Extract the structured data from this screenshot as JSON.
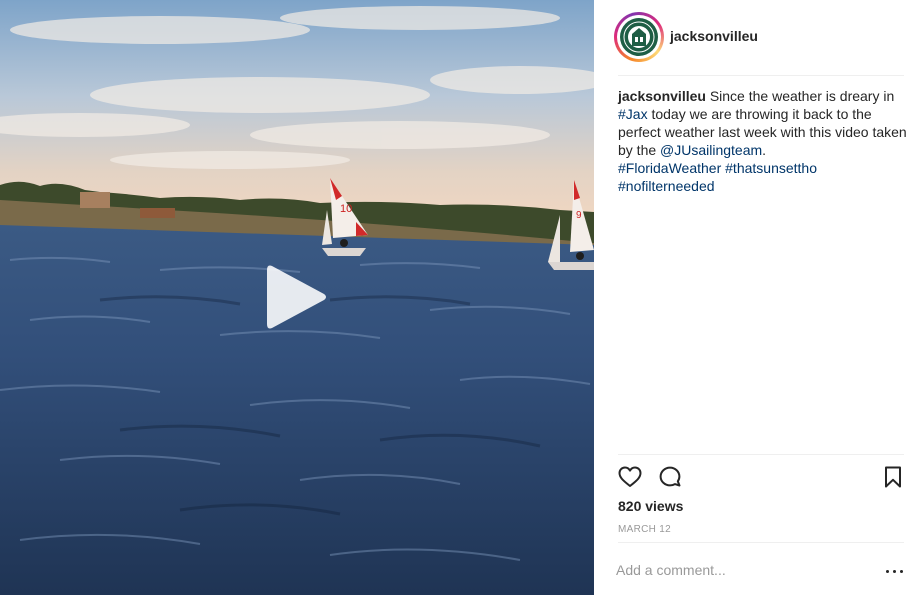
{
  "post": {
    "username": "jacksonvilleu",
    "views": "820 views",
    "date": "MARCH 12"
  },
  "caption": {
    "username": "jacksonvilleu",
    "parts": [
      " Since the weather is dreary in ",
      "#Jax",
      " today we are throwing it back to the perfect weather last week with this video taken by the ",
      "@JUsailingteam",
      ".",
      "#FloridaWeather",
      " ",
      "#thatsunsettho",
      "#nofilterneeded"
    ]
  },
  "comment": {
    "placeholder": "Add a comment..."
  },
  "media": {
    "sail_numbers": [
      "10",
      "9"
    ]
  },
  "icons": {
    "play": "play-icon",
    "like": "heart-icon",
    "comment": "comment-bubble-icon",
    "save": "bookmark-icon",
    "more": "more-dots-icon"
  },
  "colors": {
    "hashtag": "#003569",
    "text": "#262626",
    "muted": "#999999",
    "avatar_green": "#1f5e45"
  }
}
